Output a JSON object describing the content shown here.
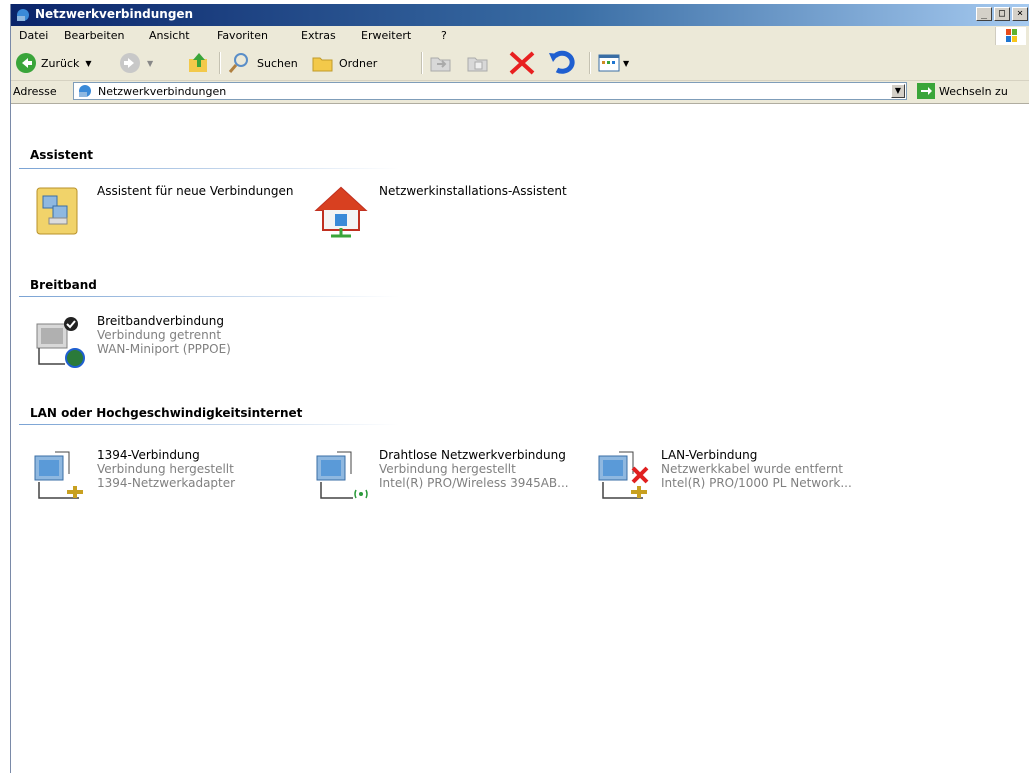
{
  "window": {
    "title": "Netzwerkverbindungen"
  },
  "menu": [
    "Datei",
    "Bearbeiten",
    "Ansicht",
    "Favoriten",
    "Extras",
    "Erweitert",
    "?"
  ],
  "toolbar": {
    "back_label": "Zurück",
    "search_label": "Suchen",
    "folders_label": "Ordner"
  },
  "address": {
    "label": "Adresse",
    "value": "Netzwerkverbindungen",
    "go_label": "Wechseln zu"
  },
  "groups": [
    {
      "title": "Assistent",
      "items": [
        {
          "name": "Assistent für neue Verbindungen",
          "icon": "wizard-icon"
        },
        {
          "name": "Netzwerkinstallations-Assistent",
          "icon": "home-network-icon"
        }
      ]
    },
    {
      "title": "Breitband",
      "items": [
        {
          "name": "Breitbandverbindung",
          "status": "Verbindung getrennt",
          "device": "WAN-Miniport (PPPOE)",
          "icon": "broadband-icon"
        }
      ]
    },
    {
      "title": "LAN oder Hochgeschwindigkeitsinternet",
      "items": [
        {
          "name": "1394-Verbindung",
          "status": "Verbindung hergestellt",
          "device": "1394-Netzwerkadapter",
          "icon": "lan-icon"
        },
        {
          "name": "Drahtlose Netzwerkverbindung",
          "status": "Verbindung hergestellt",
          "device": "Intel(R) PRO/Wireless 3945AB...",
          "icon": "wireless-icon"
        },
        {
          "name": "LAN-Verbindung",
          "status": "Netzwerkkabel wurde entfernt",
          "device": "Intel(R) PRO/1000 PL Network...",
          "icon": "lan-disconnected-icon"
        }
      ]
    }
  ]
}
